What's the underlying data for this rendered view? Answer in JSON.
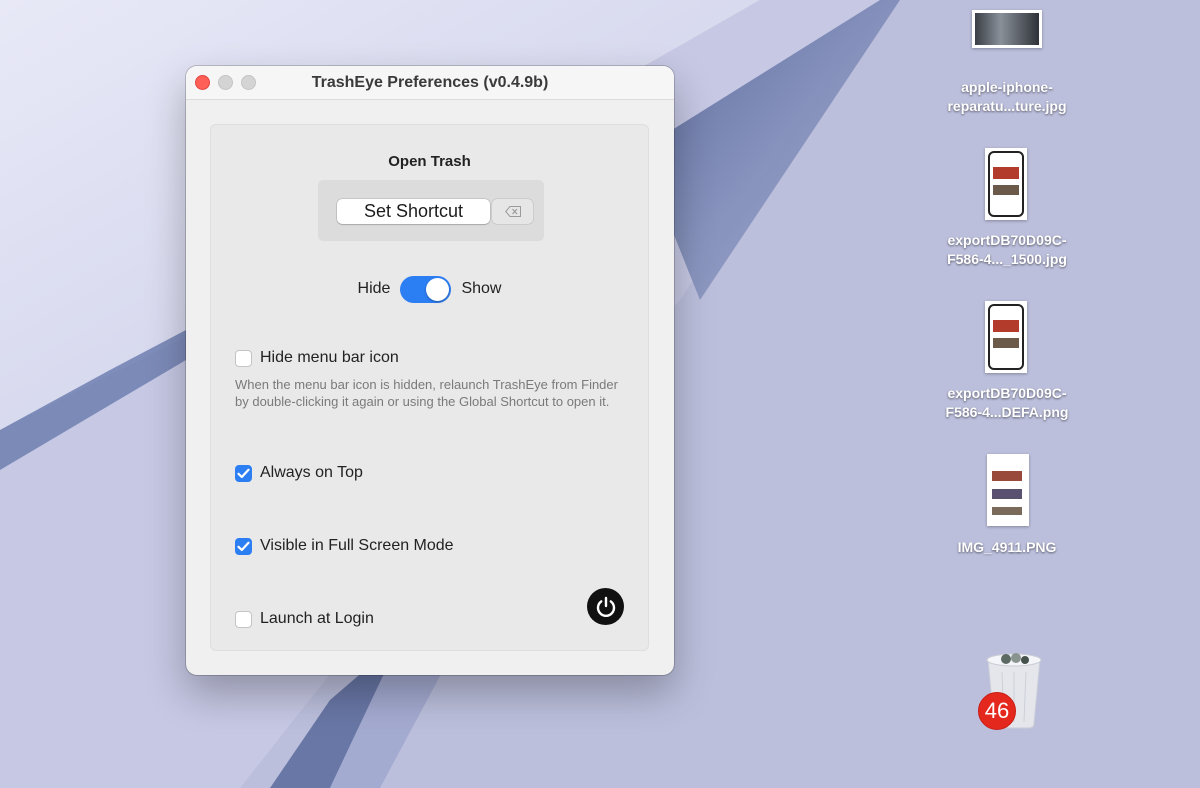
{
  "window": {
    "title": "TrashEye Preferences (v0.4.9b)"
  },
  "open_trash": {
    "heading": "Open Trash",
    "shortcut_label": "Set Shortcut"
  },
  "visibility_toggle": {
    "left_label": "Hide",
    "right_label": "Show",
    "state": "Show"
  },
  "options": {
    "hide_menu_bar_icon": {
      "label": "Hide menu bar icon",
      "checked": false
    },
    "hide_note": "When the menu bar icon is hidden, relaunch TrashEye from Finder by double-clicking it again or using the Global Shortcut to open it.",
    "always_on_top": {
      "label": "Always on Top",
      "checked": true
    },
    "visible_full_screen": {
      "label": "Visible in Full Screen Mode",
      "checked": true
    },
    "launch_at_login": {
      "label": "Launch at Login",
      "checked": false
    }
  },
  "desktop": {
    "files": [
      {
        "line1": "apple-iphone-",
        "line2": "reparatu...ture.jpg"
      },
      {
        "line1": "exportDB70D09C-",
        "line2": "F586-4..._1500.jpg"
      },
      {
        "line1": "exportDB70D09C-",
        "line2": "F586-4...DEFA.png"
      },
      {
        "line1": "IMG_4911.PNG",
        "line2": ""
      }
    ],
    "trash_count": "46"
  },
  "colors": {
    "accent": "#2c7ef3",
    "close": "#fe5f57",
    "badge": "#e5281e"
  }
}
